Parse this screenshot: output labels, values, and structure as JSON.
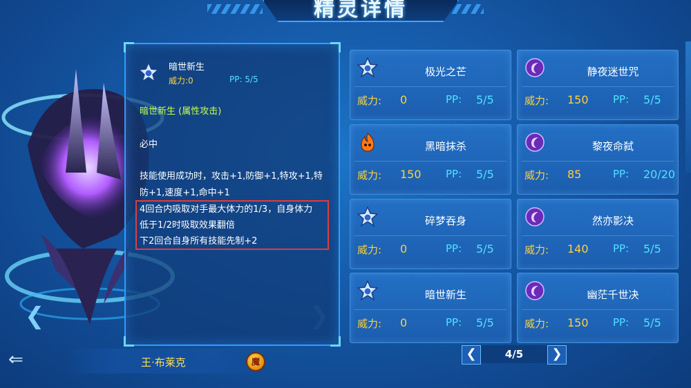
{
  "header": {
    "title": "精灵详情"
  },
  "info": {
    "skill_name": "暗世新生",
    "power_label": "威力:",
    "power_value": "0",
    "pp_label": "PP:",
    "pp_value": "5/5",
    "type_line": "暗世新生 (属性攻击)",
    "hit": "必中",
    "effect_1": "技能使用成功时，攻击+1,防御+1,特攻+1,特防+1,速度+1,命中+1",
    "effect_2_line1": "4回合内吸取对手最大体力的1/3，自身体力",
    "effect_2_line2": "低于1/2时吸取效果翻倍",
    "effect_2_line3": "下2回合自身所有技能先制+2"
  },
  "pet": {
    "name": "王·布莱克",
    "badge": "魔"
  },
  "skills": [
    {
      "name": "极光之芒",
      "power_label": "威力:",
      "power": "0",
      "pp_label": "PP:",
      "pp": "5/5",
      "icon": "star-icon"
    },
    {
      "name": "静夜迷世咒",
      "power_label": "威力:",
      "power": "150",
      "pp_label": "PP:",
      "pp": "5/5",
      "icon": "shadow-icon"
    },
    {
      "name": "黑暗抹杀",
      "power_label": "威力:",
      "power": "150",
      "pp_label": "PP:",
      "pp": "5/5",
      "icon": "fire-icon"
    },
    {
      "name": "黎夜命弑",
      "power_label": "威力:",
      "power": "85",
      "pp_label": "PP:",
      "pp": "20/20",
      "icon": "shadow-icon"
    },
    {
      "name": "碎梦吞身",
      "power_label": "威力:",
      "power": "0",
      "pp_label": "PP:",
      "pp": "5/5",
      "icon": "star-icon"
    },
    {
      "name": "然亦影决",
      "power_label": "威力:",
      "power": "140",
      "pp_label": "PP:",
      "pp": "5/5",
      "icon": "shadow-icon"
    },
    {
      "name": "暗世新生",
      "power_label": "威力:",
      "power": "0",
      "pp_label": "PP:",
      "pp": "5/5",
      "icon": "star-icon"
    },
    {
      "name": "幽茫千世决",
      "power_label": "威力:",
      "power": "150",
      "pp_label": "PP:",
      "pp": "5/5",
      "icon": "shadow-icon"
    }
  ],
  "pager": {
    "text": "4/5",
    "prev": "❮",
    "next": "❯"
  },
  "colors": {
    "accent": "#3ea6ff",
    "power": "#ffd23a",
    "pp": "#4fe3ff",
    "type": "#c8ff4a",
    "highlight_box": "#e43b3b"
  }
}
